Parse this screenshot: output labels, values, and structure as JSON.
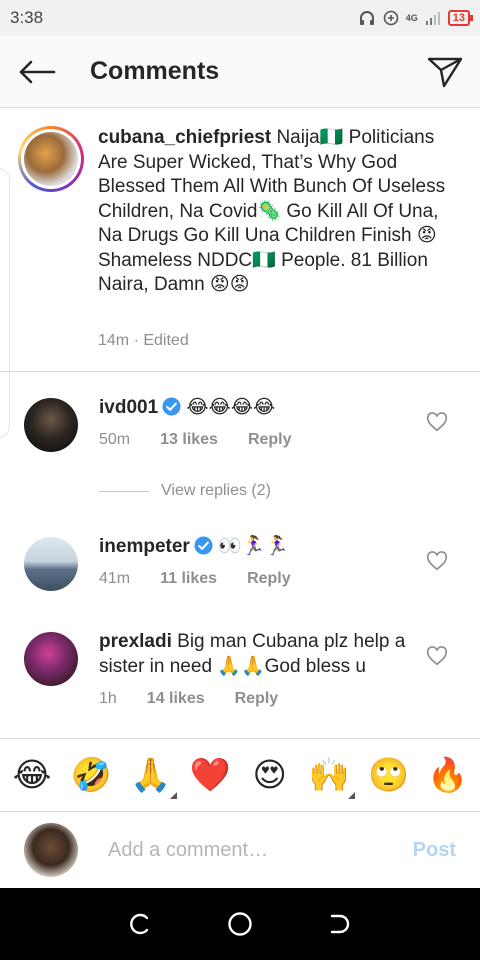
{
  "status_bar": {
    "time": "3:38",
    "network": "4G",
    "battery": "13"
  },
  "header": {
    "title": "Comments"
  },
  "caption": {
    "username": "cubana_chiefpriest",
    "text": " Naija🇳🇬 Politicians Are Super Wicked, That’s Why God Blessed Them All With Bunch Of Useless Children, Na Covid🦠 Go Kill All Of Una, Na Drugs Go Kill Una Children Finish 😡 Shameless NDDC🇳🇬 People. 81 Billion Naira, Damn 😡😡",
    "meta": "14m · Edited"
  },
  "comments": [
    {
      "username": "ivd001",
      "verified": true,
      "text": " 😂😂😂😂",
      "time": "50m",
      "likes": "13 likes",
      "reply": "Reply"
    },
    {
      "username": "inempeter",
      "verified": true,
      "text": " 👀🏃‍♀️🏃‍♀️",
      "time": "41m",
      "likes": "11 likes",
      "reply": "Reply"
    },
    {
      "username": "prexladi",
      "verified": false,
      "text": " Big man Cubana plz help a sister in need 🙏🙏God bless u",
      "time": "1h",
      "likes": "14 likes",
      "reply": "Reply"
    }
  ],
  "view_replies": "View replies (2)",
  "emoji_bar": [
    "😂",
    "🤣",
    "🙏",
    "❤️",
    "😍",
    "🙌",
    "🙄",
    "🔥"
  ],
  "add_comment": {
    "placeholder": "Add a comment…",
    "post_label": "Post"
  }
}
